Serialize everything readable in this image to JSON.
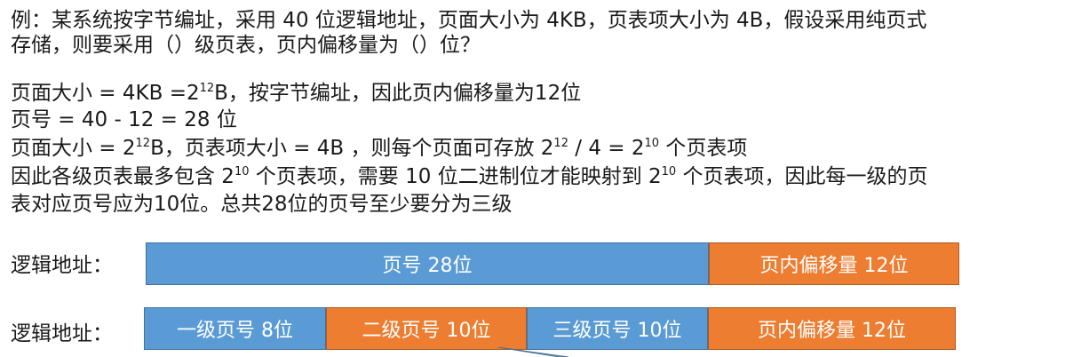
{
  "question": {
    "line1": "例：某系统按字节编址，采用 40 位逻辑地址，页面大小为 4KB，页表项大小为 4B，假设采用纯页式",
    "line2": "存储，则要采用（）级页表，页内偏移量为（）位？"
  },
  "explanation": {
    "l1_prefix": "页面大小 = 4KB =2",
    "l1_exp": "12",
    "l1_suffix": "B，按字节编址，因此页内偏移量为12位",
    "l2": "页号 = 40 - 12 = 28 位",
    "l3_a": "页面大小 = 2",
    "l3_exp1": "12",
    "l3_b": "B，页表项大小 = 4B ，则每个页面可存放 2",
    "l3_exp2": "12",
    "l3_c": " / 4  = 2",
    "l3_exp3": "10",
    "l3_d": " 个页表项",
    "l4_a": "因此各级页表最多包含 2",
    "l4_exp1": "10",
    "l4_b": " 个页表项，需要 10 位二进制位才能映射到 2",
    "l4_exp2": "10",
    "l4_c": " 个页表项，因此每一级的页",
    "l5": "表对应页号应为10位。总共28位的页号至少要分为三级"
  },
  "diagram1": {
    "label": "逻辑地址：",
    "segments": [
      {
        "text": "页号  28位",
        "color": "#5b9bd5"
      },
      {
        "text": "页内偏移量 12位",
        "color": "#ed7d31"
      }
    ]
  },
  "diagram2": {
    "label": "逻辑地址：",
    "segments": [
      {
        "text": "一级页号 8位",
        "color": "#5b9bd5"
      },
      {
        "text": "二级页号 10位",
        "color": "#ed7d31"
      },
      {
        "text": "三级页号 10位",
        "color": "#5b9bd5"
      },
      {
        "text": "页内偏移量 12位",
        "color": "#ed7d31"
      }
    ]
  }
}
